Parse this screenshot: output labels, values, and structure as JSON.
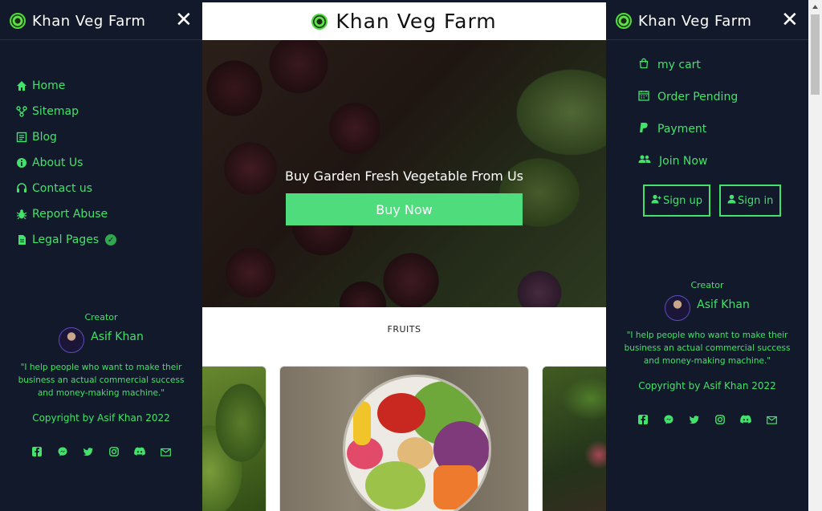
{
  "site": {
    "brand": "Khan Veg Farm"
  },
  "hero": {
    "headline": "Buy Garden Fresh Vegetable From Us",
    "cta": "Buy Now"
  },
  "section": {
    "title": "FRUITS"
  },
  "left_sidebar": {
    "brand": "Khan Veg Farm",
    "close": "✕",
    "items": [
      {
        "label": "Home",
        "icon": "home-icon"
      },
      {
        "label": "Sitemap",
        "icon": "sitemap-icon"
      },
      {
        "label": "Blog",
        "icon": "blog-icon"
      },
      {
        "label": "About Us",
        "icon": "info-icon"
      },
      {
        "label": "Contact us",
        "icon": "headset-icon"
      },
      {
        "label": "Report Abuse",
        "icon": "bug-icon"
      },
      {
        "label": "Legal Pages",
        "icon": "document-icon"
      }
    ]
  },
  "right_sidebar": {
    "brand": "Khan Veg Farm",
    "close": "✕",
    "items": [
      {
        "label": "my cart",
        "icon": "cart-icon"
      },
      {
        "label": "Order Pending",
        "icon": "calendar-icon"
      },
      {
        "label": "Payment",
        "icon": "paypal-icon"
      },
      {
        "label": "Join Now",
        "icon": "users-icon"
      }
    ],
    "signup": "Sign up",
    "signin": "Sign in"
  },
  "creator": {
    "label": "Creator",
    "name": "Asif Khan",
    "quote": "\"I help people who want to make their business an actual commercial success and money-making machine.\"",
    "copyright": "Copyright by Asif Khan 2022"
  },
  "colors": {
    "sidebar_bg": "#11192b",
    "accent": "#43e26a",
    "cta_bg": "#4fdc7c"
  }
}
